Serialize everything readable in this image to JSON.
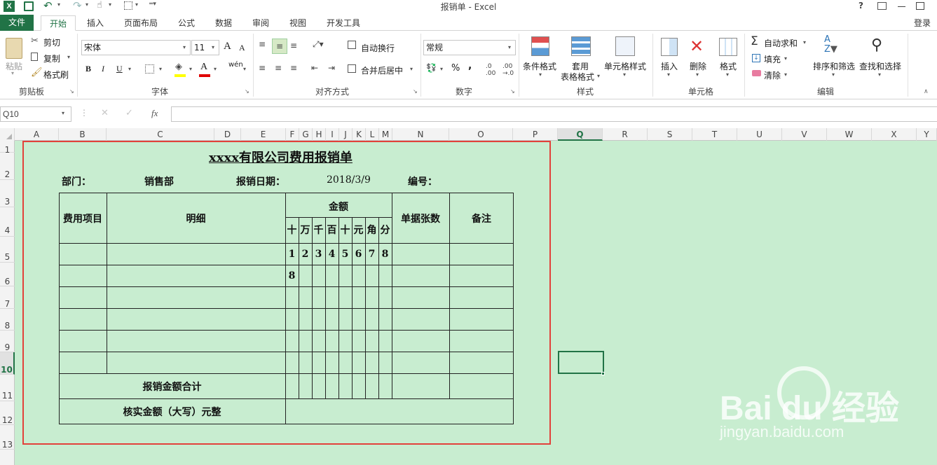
{
  "window_title": "报销单 - Excel",
  "title_controls": [
    "?",
    "□",
    "—",
    "□"
  ],
  "qat_items": [
    "save-icon",
    "undo-icon",
    "redo-icon",
    "touch-icon",
    "border-icon",
    "customize-icon"
  ],
  "tabs": [
    "文件",
    "开始",
    "插入",
    "页面布局",
    "公式",
    "数据",
    "审阅",
    "视图",
    "开发工具"
  ],
  "login": "登录",
  "ribbon": {
    "clipboard": {
      "paste": "粘贴",
      "cut": "剪切",
      "copy": "复制",
      "painter": "格式刷",
      "label": "剪贴板"
    },
    "font": {
      "name": "宋体",
      "size": "11",
      "grow": "A",
      "shrink": "A",
      "bold": "B",
      "italic": "I",
      "underline": "U",
      "wen": "wén",
      "label": "字体"
    },
    "align": {
      "wrap": "自动换行",
      "merge": "合并后居中",
      "label": "对齐方式"
    },
    "number": {
      "format": "常规",
      "percent": "%",
      "comma": ",",
      "label": "数字"
    },
    "styles": {
      "cond": "条件格式",
      "table1": "套用",
      "table2": "表格格式",
      "cell": "单元格样式",
      "label": "样式"
    },
    "cells": {
      "insert": "插入",
      "delete": "删除",
      "format": "格式",
      "label": "单元格"
    },
    "edit": {
      "autosum": "自动求和",
      "fill": "填充",
      "clear": "清除",
      "sort": "排序和筛选",
      "find": "查找和选择",
      "label": "编辑"
    }
  },
  "formula_bar": {
    "name_box": "Q10",
    "cancel": "✕",
    "enter": "✓",
    "fx": "fx",
    "value": ""
  },
  "columns": [
    "A",
    "B",
    "C",
    "D",
    "E",
    "F",
    "G",
    "H",
    "I",
    "J",
    "K",
    "L",
    "M",
    "N",
    "O",
    "P",
    "Q",
    "R",
    "S",
    "T",
    "U",
    "V",
    "W",
    "X",
    "Y"
  ],
  "rows": [
    "1",
    "2",
    "3",
    "4",
    "5",
    "6",
    "7",
    "8",
    "9",
    "10",
    "11",
    "12",
    "13"
  ],
  "selected_cell": "Q10",
  "form": {
    "title": "xxxx有限公司费用报销单",
    "dept_label": "部门：",
    "dept_value": "销售部",
    "date_label": "报销日期：",
    "date_value": "2018/3/9",
    "no_label": "编号：",
    "h_item": "费用项目",
    "h_detail": "明细",
    "h_amount": "金额",
    "h_receipts": "单据张数",
    "h_note": "备注",
    "digit_headers": [
      "十",
      "万",
      "千",
      "百",
      "十",
      "元",
      "角",
      "分"
    ],
    "row1_digits": [
      "1",
      "2",
      "3",
      "4",
      "5",
      "6",
      "7",
      "8"
    ],
    "row2_digits": [
      "8",
      "",
      "",
      "",
      "",
      "",
      "",
      ""
    ],
    "total_label": "报销金额合计",
    "verified_label": "核实金额（大写）元整"
  },
  "watermark": {
    "brand": "Bai du 经验",
    "url": "jingyan.baidu.com"
  }
}
